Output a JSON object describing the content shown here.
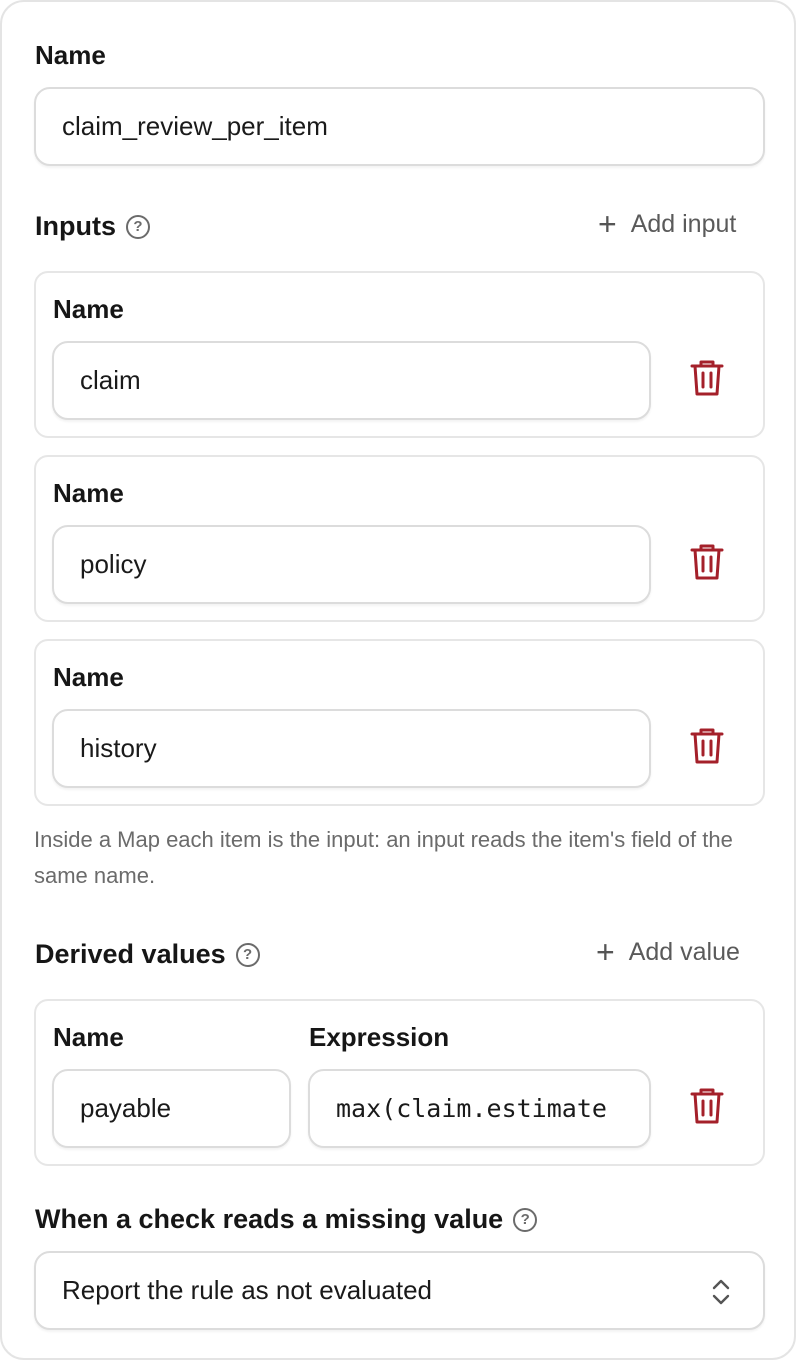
{
  "name_section": {
    "label": "Name",
    "value": "claim_review_per_item"
  },
  "inputs": {
    "title": "Inputs",
    "help": "?",
    "add_label": "Add input",
    "field_label": "Name",
    "items": [
      {
        "value": "claim"
      },
      {
        "value": "policy"
      },
      {
        "value": "history"
      }
    ],
    "hint": "Inside a Map each item is the input: an input reads the item's field of the same name."
  },
  "derived": {
    "title": "Derived values",
    "help": "?",
    "add_label": "Add value",
    "name_label": "Name",
    "expression_label": "Expression",
    "items": [
      {
        "name": "payable",
        "expression": "max(claim.estimate"
      }
    ]
  },
  "missing": {
    "title": "When a check reads a missing value",
    "help": "?",
    "selected": "Report the rule as not evaluated"
  },
  "colors": {
    "delete_icon": "#a4202a",
    "border": "#dcdcdc"
  }
}
